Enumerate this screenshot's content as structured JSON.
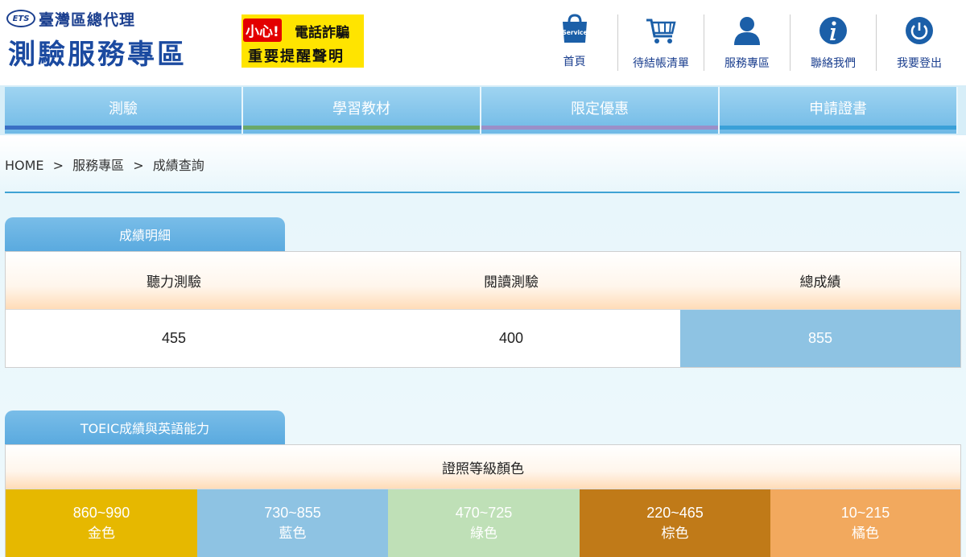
{
  "header": {
    "ets_mark": "ETS",
    "subtitle": "臺灣區總代理",
    "title": "測驗服務專區",
    "alert": {
      "careful": "小心!",
      "line1": "電話詐騙",
      "line2": "重要提醒聲明"
    }
  },
  "topnav": [
    {
      "label": "首頁",
      "icon": "service-bag-icon",
      "icon_text": "Service"
    },
    {
      "label": "待結帳清單",
      "icon": "cart-icon"
    },
    {
      "label": "服務專區",
      "icon": "user-icon"
    },
    {
      "label": "聯絡我們",
      "icon": "info-icon"
    },
    {
      "label": "我要登出",
      "icon": "power-icon"
    }
  ],
  "menu": [
    {
      "label": "測驗",
      "stripe": "#3a6fc4"
    },
    {
      "label": "學習教材",
      "stripe": "#6aa86a"
    },
    {
      "label": "限定優惠",
      "stripe": "#9b8fc8"
    },
    {
      "label": "申請證書",
      "stripe": "#3aa0d8"
    }
  ],
  "breadcrumb": {
    "home": "HOME",
    "sep": ">",
    "level1": "服務專區",
    "level2": "成績查詢"
  },
  "scores": {
    "tab": "成績明細",
    "headers": [
      "聽力測驗",
      "閱讀測驗",
      "總成績"
    ],
    "values": [
      "455",
      "400",
      "855"
    ]
  },
  "levels": {
    "tab": "TOEIC成績與英語能力",
    "header": "證照等級顏色",
    "items": [
      {
        "range": "860~990",
        "color_name": "金色",
        "bg": "#e6b800"
      },
      {
        "range": "730~855",
        "color_name": "藍色",
        "bg": "#8ec3e3"
      },
      {
        "range": "470~725",
        "color_name": "綠色",
        "bg": "#bfe0b7"
      },
      {
        "range": "220~465",
        "color_name": "棕色",
        "bg": "#c07a18"
      },
      {
        "range": "10~215",
        "color_name": "橘色",
        "bg": "#f2a95e"
      }
    ]
  }
}
